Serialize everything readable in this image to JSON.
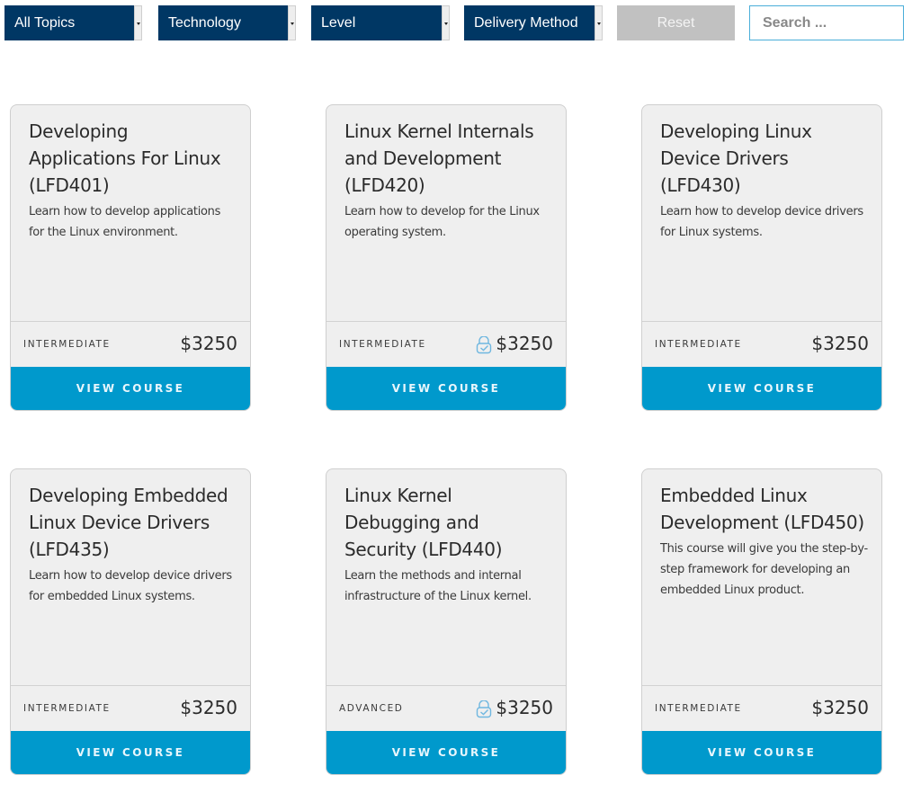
{
  "filters": {
    "topics": "All Topics",
    "technology": "Technology",
    "level": "Level",
    "delivery": "Delivery Method",
    "reset_label": "Reset",
    "search_placeholder": "Search ..."
  },
  "colors": {
    "select_bg": "#003764",
    "button_bg": "#0099cc",
    "reset_bg": "#c1c1c1",
    "search_border": "#4aaed9",
    "card_bg": "#efefef"
  },
  "courses": [
    {
      "title": "Developing Applications For Linux (LFD401)",
      "description": "Learn how to develop applications for the Linux environment.",
      "level": "INTERMEDIATE",
      "price": "$3250",
      "lock_icon": false,
      "button": "VIEW COURSE"
    },
    {
      "title": "Linux Kernel Internals and Development (LFD420)",
      "description": "Learn how to develop for the Linux operating system.",
      "level": "INTERMEDIATE",
      "price": "$3250",
      "lock_icon": true,
      "button": "VIEW COURSE"
    },
    {
      "title": "Developing Linux Device Drivers (LFD430)",
      "description": "Learn how to develop device drivers for Linux systems.",
      "level": "INTERMEDIATE",
      "price": "$3250",
      "lock_icon": false,
      "button": "VIEW COURSE"
    },
    {
      "title": "Developing Embedded Linux Device Drivers (LFD435)",
      "description": "Learn how to develop device drivers for embedded Linux systems.",
      "level": "INTERMEDIATE",
      "price": "$3250",
      "lock_icon": false,
      "button": "VIEW COURSE"
    },
    {
      "title": "Linux Kernel Debugging and Security (LFD440)",
      "description": "Learn the methods and internal infrastructure of the Linux kernel.",
      "level": "ADVANCED",
      "price": "$3250",
      "lock_icon": true,
      "button": "VIEW COURSE"
    },
    {
      "title": "Embedded Linux Development (LFD450)",
      "description": "This course will give you the step-by-step framework for developing an embedded Linux product.",
      "level": "INTERMEDIATE",
      "price": "$3250",
      "lock_icon": false,
      "button": "VIEW COURSE"
    }
  ]
}
